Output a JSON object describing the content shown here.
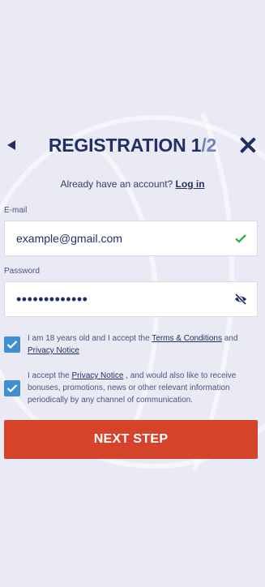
{
  "header": {
    "title_main": "REGISTRATION 1",
    "title_sep": "/2"
  },
  "login": {
    "prompt": "Already have an account?",
    "link": "Log in"
  },
  "email": {
    "label": "E-mail",
    "value": "example@gmail.com",
    "status_icon": "check-icon"
  },
  "password": {
    "label": "Password",
    "value": "•••••••••••••",
    "toggle_icon": "eye-hidden-icon"
  },
  "consent_terms": {
    "checked": true,
    "text_1": "I am 18 years old and I accept the",
    "link_1": "Terms & Conditions",
    "text_2": "and",
    "link_2": "Privacy Notice"
  },
  "consent_marketing": {
    "checked": true,
    "text_1": "I accept the",
    "link_1": "Privacy Notice",
    "text_2": ", and would also like to receive bonuses, promotions, news or other relevant information periodically by any channel of communication."
  },
  "next_button": {
    "label": "NEXT STEP"
  },
  "colors": {
    "background": "#e9eaf4",
    "primary": "#232f63",
    "accent": "#d6432b",
    "checkbox": "#3f8fd2",
    "success": "#3bab4a"
  }
}
